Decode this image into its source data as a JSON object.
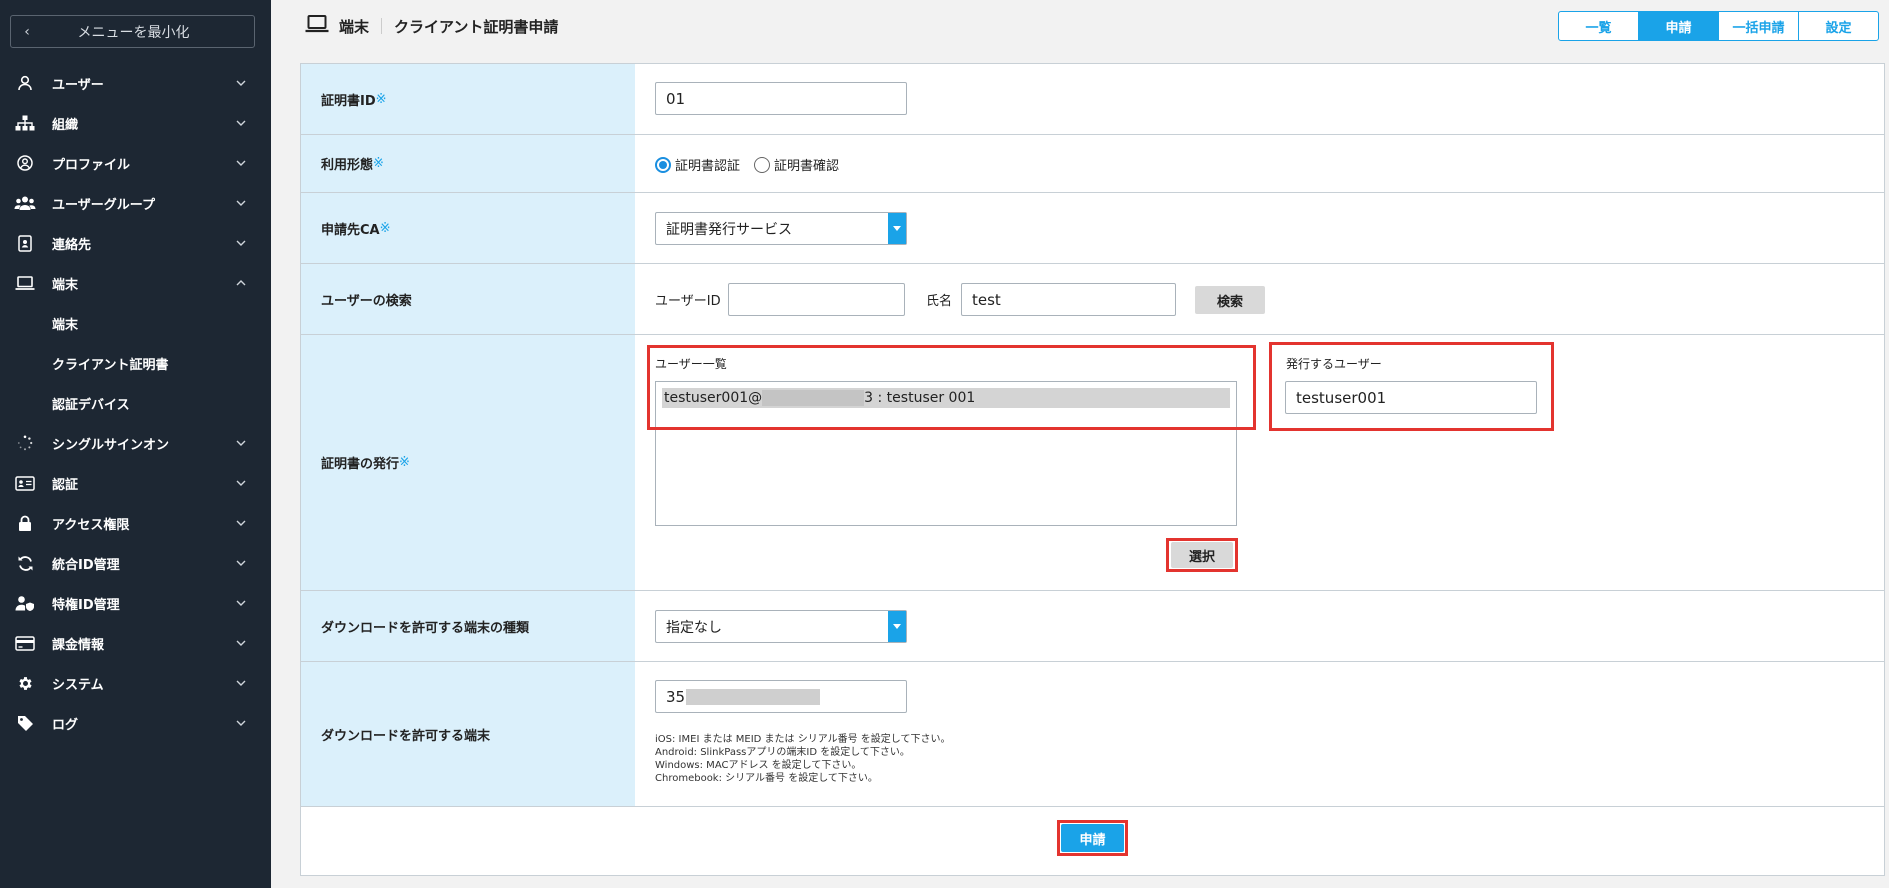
{
  "sidebar": {
    "minimize_label": "メニューを最小化",
    "items": [
      {
        "label": "ユーザー"
      },
      {
        "label": "組織"
      },
      {
        "label": "プロファイル"
      },
      {
        "label": "ユーザーグループ"
      },
      {
        "label": "連絡先"
      },
      {
        "label": "端末"
      },
      {
        "label": "シングルサインオン"
      },
      {
        "label": "認証"
      },
      {
        "label": "アクセス権限"
      },
      {
        "label": "統合ID管理"
      },
      {
        "label": "特権ID管理"
      },
      {
        "label": "課金情報"
      },
      {
        "label": "システム"
      },
      {
        "label": "ログ"
      }
    ],
    "sub_items": [
      {
        "label": "端末"
      },
      {
        "label": "クライアント証明書"
      },
      {
        "label": "認証デバイス"
      }
    ]
  },
  "header": {
    "section": "端末",
    "title": "クライアント証明書申請",
    "tabs": [
      {
        "label": "一覧"
      },
      {
        "label": "申請"
      },
      {
        "label": "一括申請"
      },
      {
        "label": "設定"
      }
    ]
  },
  "form": {
    "required_mark": "※",
    "cert_id": {
      "label": "証明書ID",
      "value": "01"
    },
    "usage": {
      "label": "利用形態",
      "options": [
        "証明書認証",
        "証明書確認"
      ],
      "selected": "証明書認証"
    },
    "ca": {
      "label": "申請先CA",
      "value": "証明書発行サービス"
    },
    "user_search": {
      "label": "ユーザーの検索",
      "user_id_label": "ユーザーID",
      "user_id_value": "",
      "name_label": "氏名",
      "name_value": "test",
      "search_button": "検索"
    },
    "issue": {
      "label": "証明書の発行",
      "user_list_title": "ユーザー一覧",
      "user_list_item_prefix": "testuser001@",
      "user_list_item_suffix": "3 : testuser 001",
      "issue_user_title": "発行するユーザー",
      "issue_user_value": "testuser001",
      "select_button": "選択"
    },
    "device_type": {
      "label": "ダウンロードを許可する端末の種類",
      "value": "指定なし"
    },
    "device": {
      "label": "ダウンロードを許可する端末",
      "value_prefix": "35",
      "help": [
        "iOS: IMEI または MEID または シリアル番号 を設定して下さい。",
        "Android: SlinkPassアプリの端末ID を設定して下さい。",
        "Windows: MACアドレス を設定して下さい。",
        "Chromebook: シリアル番号 を設定して下さい。"
      ]
    },
    "submit_button": "申請"
  }
}
